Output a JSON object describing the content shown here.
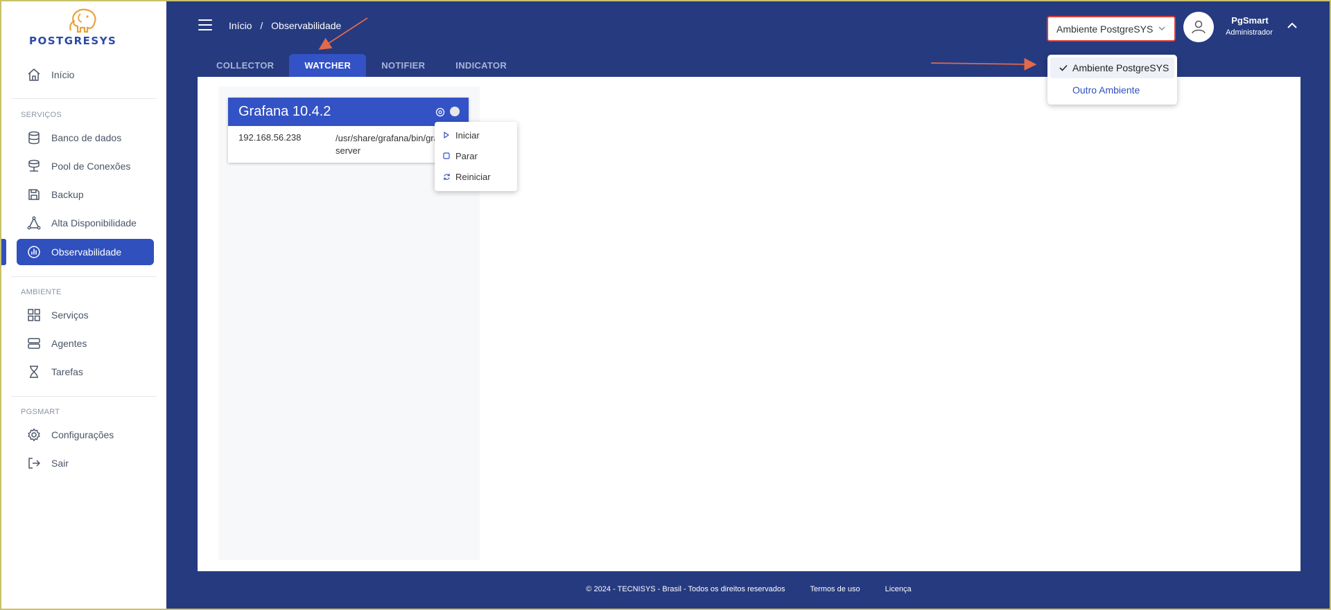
{
  "brand": {
    "logo_text": "POSTGRESYS"
  },
  "sidebar": {
    "items": [
      {
        "label": "Início",
        "icon": "home-icon"
      },
      {
        "label": "Banco de dados",
        "icon": "database-icon"
      },
      {
        "label": "Pool de Conexões",
        "icon": "server-pool-icon"
      },
      {
        "label": "Backup",
        "icon": "save-icon"
      },
      {
        "label": "Alta Disponibilidade",
        "icon": "triangle-nodes-icon"
      },
      {
        "label": "Observabilidade",
        "icon": "chart-icon",
        "active": true
      },
      {
        "label": "Serviços",
        "icon": "grid-icon"
      },
      {
        "label": "Agentes",
        "icon": "servers-icon"
      },
      {
        "label": "Tarefas",
        "icon": "hourglass-icon"
      },
      {
        "label": "Configurações",
        "icon": "gear-icon"
      },
      {
        "label": "Sair",
        "icon": "logout-icon"
      }
    ],
    "sections": {
      "servicos": "SERVIÇOS",
      "ambiente": "AMBIENTE",
      "pgsmart": "PGSMART"
    }
  },
  "header": {
    "breadcrumb": {
      "home": "Início",
      "separator": "/",
      "current": "Observabilidade"
    },
    "environment_select": {
      "value": "Ambiente PostgreSYS"
    },
    "user": {
      "name": "PgSmart",
      "role": "Administrador"
    }
  },
  "tabs": [
    {
      "label": "COLLECTOR"
    },
    {
      "label": "WATCHER",
      "active": true
    },
    {
      "label": "NOTIFIER"
    },
    {
      "label": "INDICATOR"
    }
  ],
  "environment_dropdown": {
    "options": [
      {
        "label": "Ambiente PostgreSYS",
        "selected": true
      },
      {
        "label": "Outro Ambiente"
      }
    ]
  },
  "service_card": {
    "title": "Grafana 10.4.2",
    "ip": "192.168.56.238",
    "path": "/usr/share/grafana/bin/grafana server"
  },
  "context_menu": {
    "items": [
      {
        "label": "Iniciar"
      },
      {
        "label": "Parar"
      },
      {
        "label": "Reiniciar"
      }
    ]
  },
  "footer": {
    "copyright": "© 2024 - TECNISYS - Brasil - Todos os direitos reservados",
    "terms": "Termos de uso",
    "license": "Licença"
  },
  "colors": {
    "primary": "#263a80",
    "accent": "#3352c5",
    "annotation": "#e06a4a",
    "highlight_border": "#d9413b"
  }
}
